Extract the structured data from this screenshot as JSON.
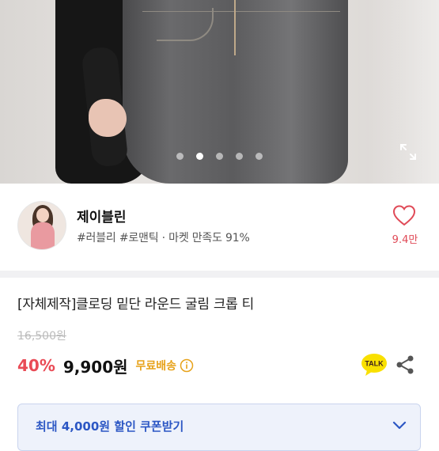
{
  "gallery": {
    "total_images": 5,
    "active_index": 1
  },
  "seller": {
    "name": "제이블린",
    "tags": "#러블리 #로맨틱 · 마켓 만족도 91%",
    "likes": "9.4만"
  },
  "product": {
    "title": "[자체제작]클로딩 밑단 라운드 굴림 크롭 티",
    "original_price": "16,500원",
    "discount": "40%",
    "price": "9,900원",
    "shipping": "무료배송"
  },
  "actions": {
    "talk_label": "TALK"
  },
  "coupon": {
    "label": "최대 4,000원 할인 쿠폰받기"
  },
  "colors": {
    "accent_red": "#e94b56",
    "shipping_orange": "#e7a21a",
    "coupon_blue": "#2c57c4",
    "kakao_yellow": "#f9e000"
  }
}
